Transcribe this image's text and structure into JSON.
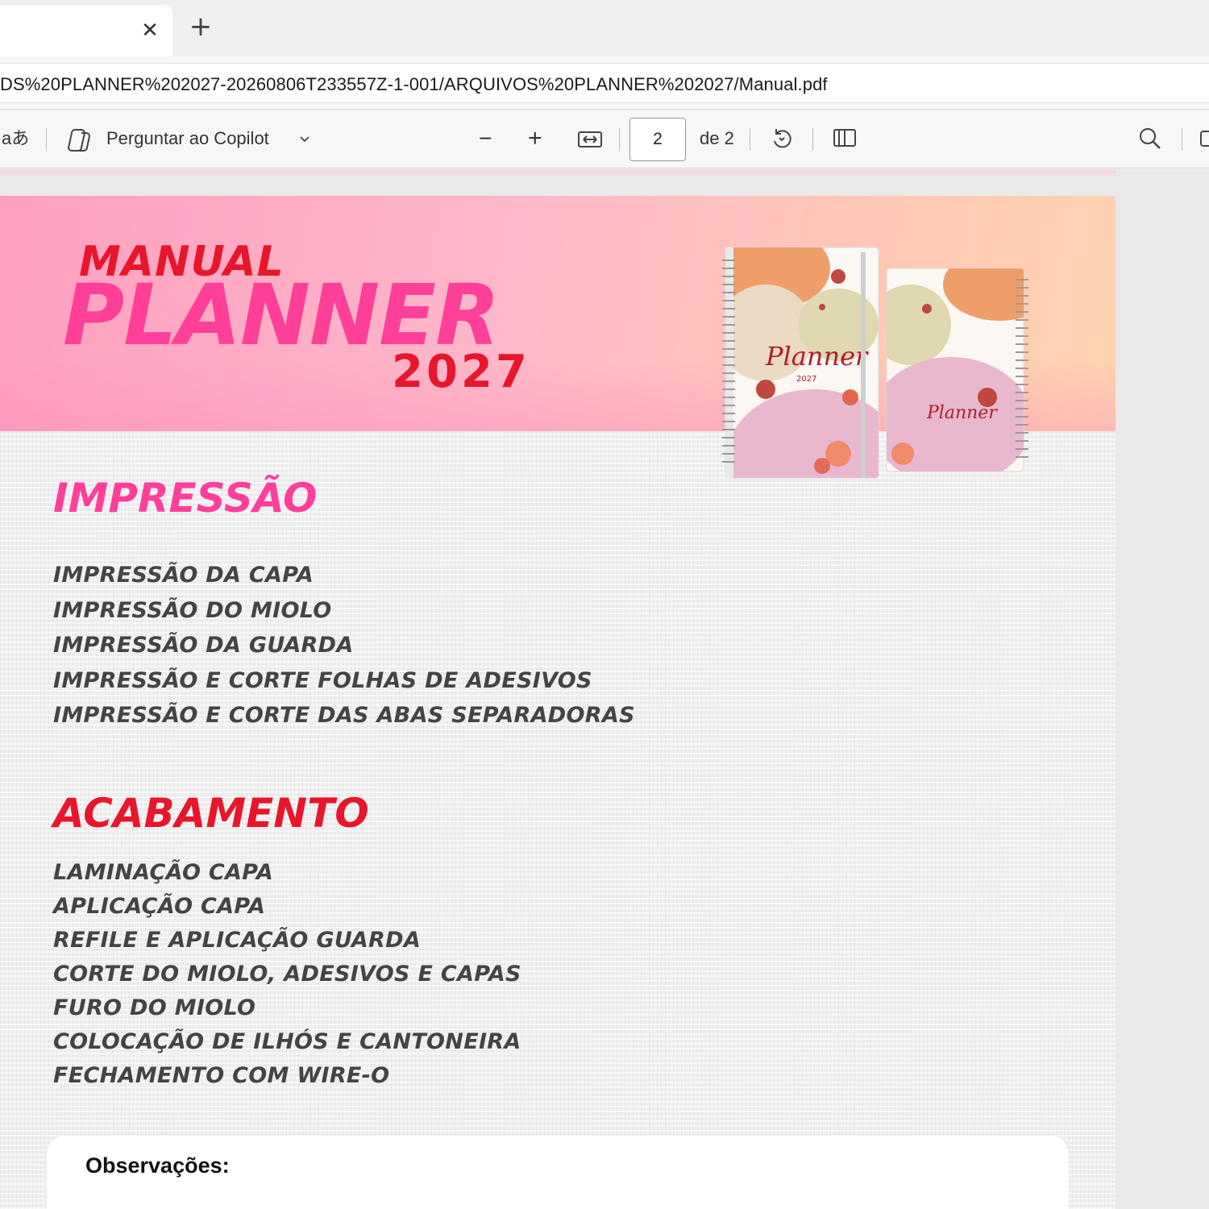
{
  "browser": {
    "tab": {
      "close_icon": "close-icon",
      "new_tab_icon": "plus-icon"
    },
    "url": "DS%20PLANNER%202027-20260806T233557Z-1-001/ARQUIVOS%20PLANNER%202027/Manual.pdf"
  },
  "pdf_toolbar": {
    "read_aloud_label": "aあ",
    "copilot_label": "Perguntar ao Copilot",
    "zoom_out_label": "−",
    "zoom_in_label": "+",
    "current_page": "2",
    "page_total_label": "de 2"
  },
  "document": {
    "title_line1": "MANUAL",
    "title_line2": "PLANNER",
    "title_year": "2027",
    "mockup_text": "Planner",
    "mockup_year": "2027",
    "section1": {
      "title": "IMPRESSÃO",
      "items": [
        "IMPRESSÃO DA CAPA",
        "IMPRESSÃO DO MIOLO",
        "IMPRESSÃO DA GUARDA",
        "IMPRESSÃO E CORTE FOLHAS DE ADESIVOS",
        "IMPRESSÃO E CORTE DAS ABAS SEPARADORAS"
      ]
    },
    "section2": {
      "title": "ACABAMENTO",
      "items": [
        "LAMINAÇÃO CAPA",
        "APLICAÇÃO CAPA",
        "REFILE E APLICAÇÃO GUARDA",
        "CORTE DO MIOLO, ADESIVOS E CAPAS",
        "FURO DO MIOLO",
        "COLOCAÇÃO DE ILHÓS E CANTONEIRA",
        "FECHAMENTO COM WIRE-O"
      ]
    },
    "observations_label": "Observações:"
  },
  "colors": {
    "pink": "#ff3f98",
    "red": "#e8162a",
    "list_text": "#444444"
  }
}
